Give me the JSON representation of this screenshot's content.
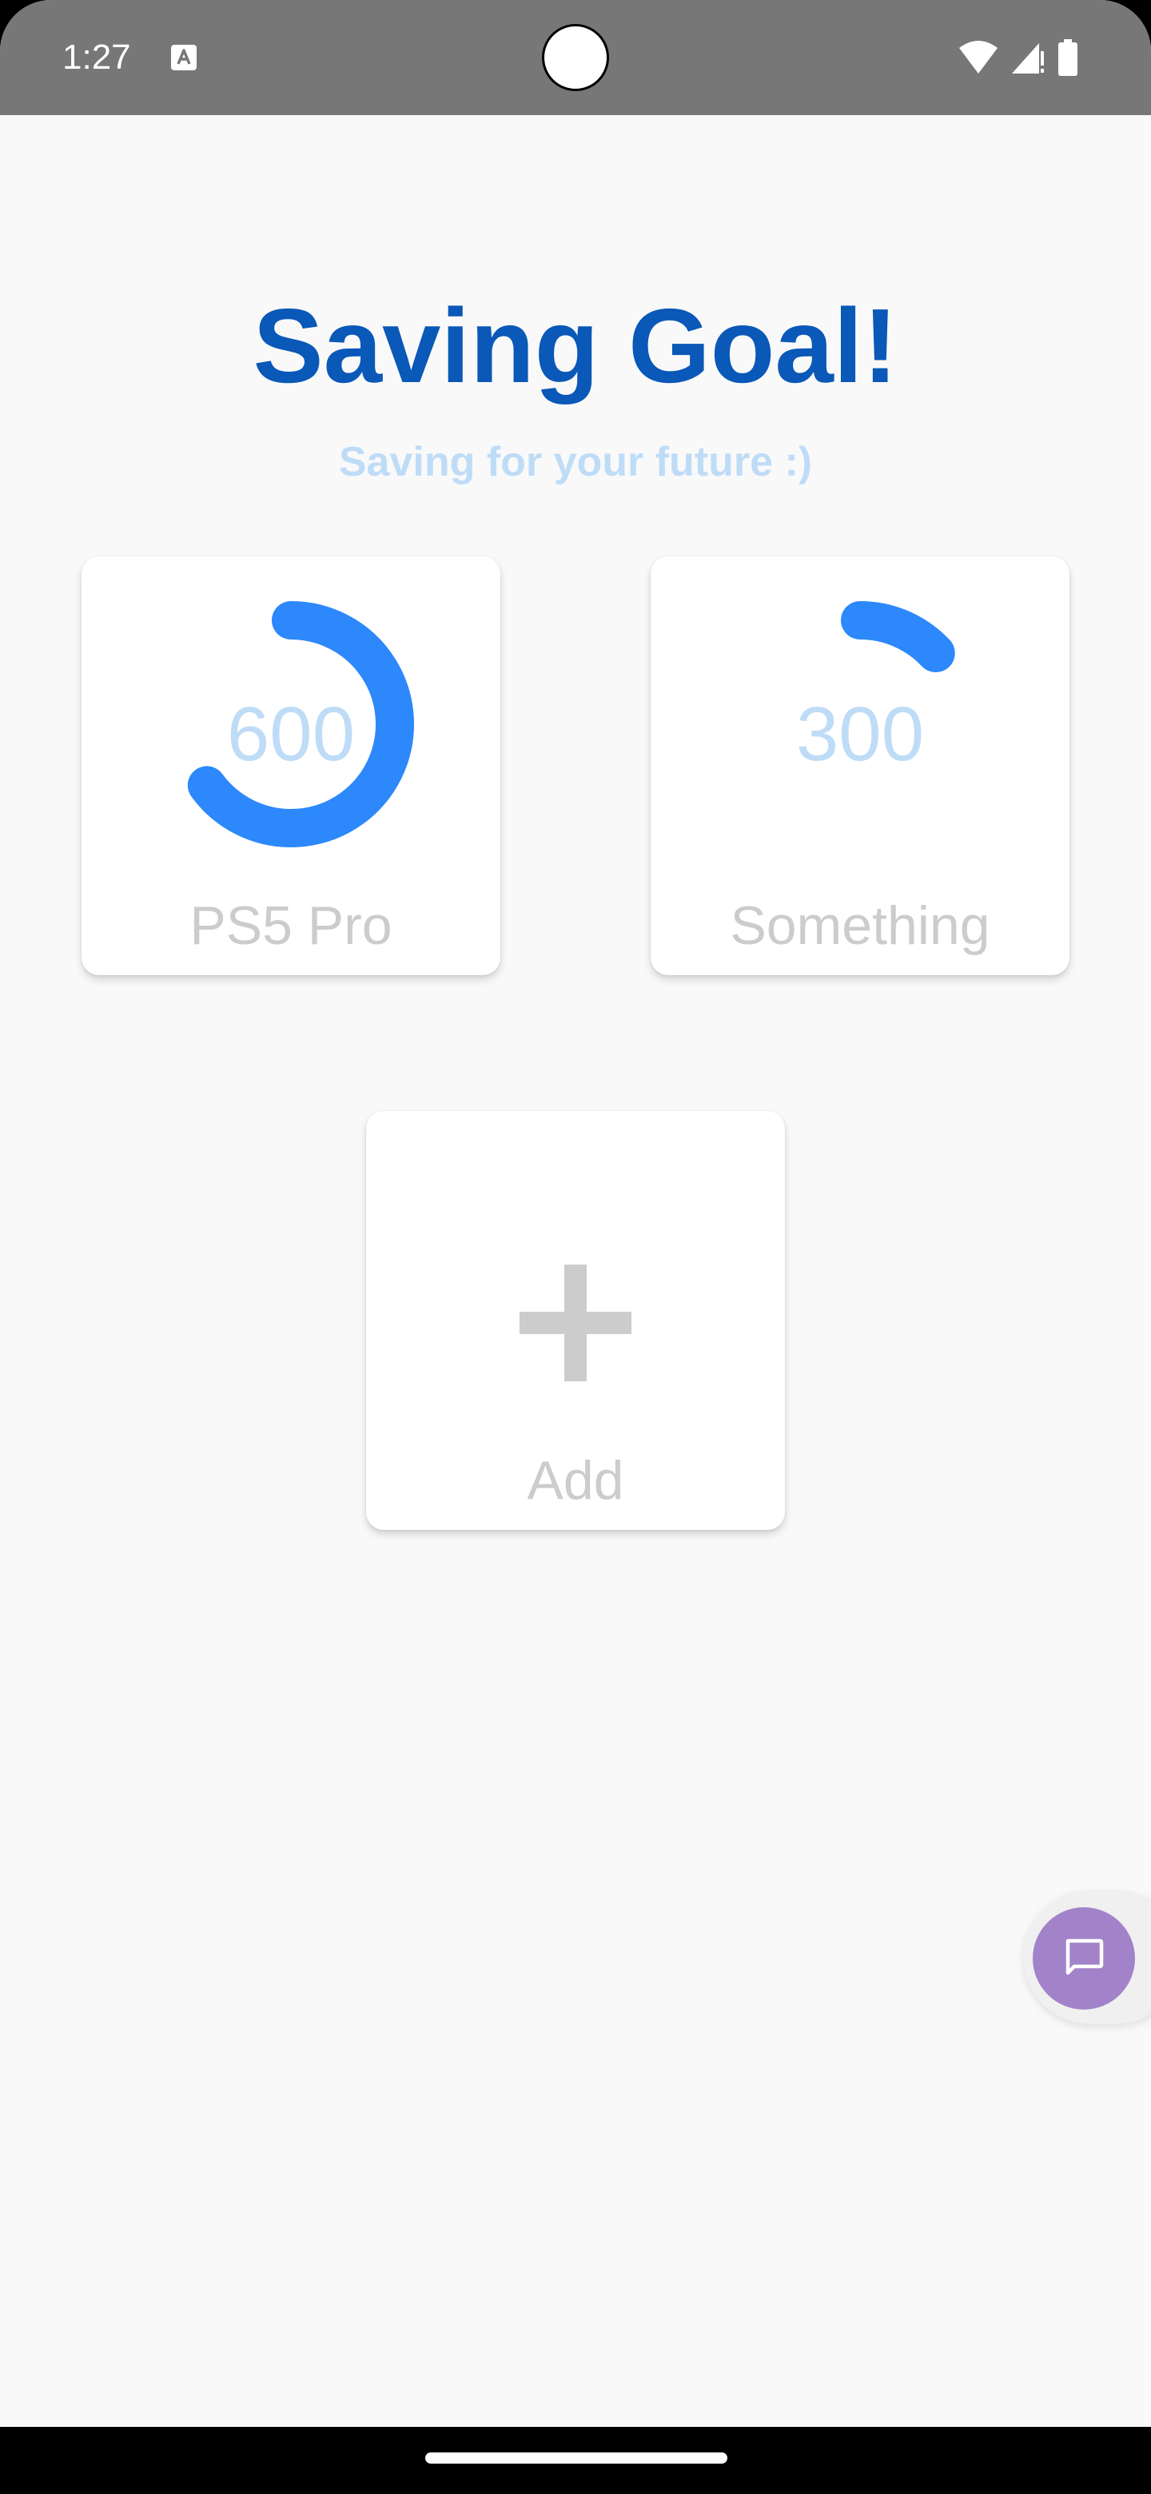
{
  "status_bar": {
    "time": "1:27",
    "icons": [
      "text-a-notification-icon",
      "wifi-icon",
      "cellular-signal-icon",
      "battery-icon"
    ]
  },
  "header": {
    "title": "Saving Goal!",
    "subtitle": "Saving for your future :)"
  },
  "goals": [
    {
      "value": "600",
      "label": "PS5 Pro",
      "progress": 0.65
    },
    {
      "value": "300",
      "label": "Something",
      "progress": 0.13
    }
  ],
  "add_card": {
    "label": "Add",
    "icon": "plus-icon"
  },
  "chat_fab": {
    "icon": "chat-bubble-icon"
  },
  "colors": {
    "title": "#0a58b8",
    "subtitle": "#bfdcf7",
    "ring": "#2c88fb",
    "card_value": "#bfdcf7",
    "card_label": "#cccccc",
    "fab": "#a283c9",
    "status_bar": "#777777",
    "background": "#f9f9f9"
  }
}
